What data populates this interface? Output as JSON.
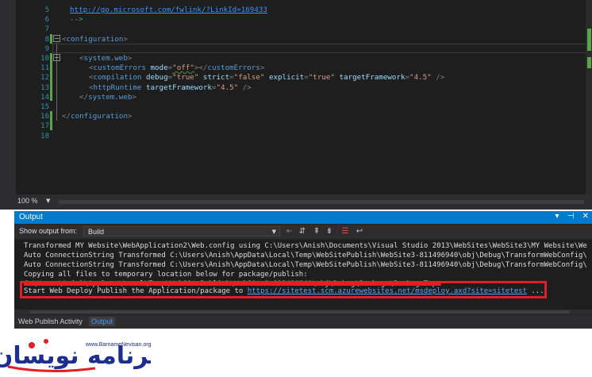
{
  "editor": {
    "lines": [
      {
        "num": "5",
        "code": [
          {
            "t": "link",
            "v": "http://go.microsoft.com/fwlink/?LinkId=169433"
          }
        ]
      },
      {
        "num": "6",
        "code": [
          {
            "t": "cmt",
            "v": "-->"
          }
        ]
      },
      {
        "num": "7",
        "code": []
      },
      {
        "num": "8",
        "code": [
          {
            "t": "punc",
            "v": "<"
          },
          {
            "t": "tag",
            "v": "configuration"
          },
          {
            "t": "punc",
            "v": ">"
          }
        ]
      },
      {
        "num": "9",
        "code": []
      },
      {
        "num": "10",
        "code": [
          {
            "t": "punc",
            "v": "<"
          },
          {
            "t": "tag",
            "v": "system.web"
          },
          {
            "t": "punc",
            "v": ">"
          }
        ]
      },
      {
        "num": "11",
        "code": [
          {
            "t": "punc",
            "v": "<"
          },
          {
            "t": "tag",
            "v": "customErrors"
          },
          {
            "t": "txt",
            "v": " "
          },
          {
            "t": "attr",
            "v": "mode"
          },
          {
            "t": "punc",
            "v": "="
          },
          {
            "t": "val",
            "v": "\"off\""
          },
          {
            "t": "punc",
            "v": "></"
          },
          {
            "t": "tag",
            "v": "customErrors"
          },
          {
            "t": "punc",
            "v": ">"
          }
        ]
      },
      {
        "num": "12",
        "code": [
          {
            "t": "punc",
            "v": "<"
          },
          {
            "t": "tag",
            "v": "compilation"
          },
          {
            "t": "txt",
            "v": " "
          },
          {
            "t": "attr",
            "v": "debug"
          },
          {
            "t": "punc",
            "v": "="
          },
          {
            "t": "val",
            "v": "\"true\""
          },
          {
            "t": "txt",
            "v": " "
          },
          {
            "t": "attr",
            "v": "strict"
          },
          {
            "t": "punc",
            "v": "="
          },
          {
            "t": "val",
            "v": "\"false\""
          },
          {
            "t": "txt",
            "v": " "
          },
          {
            "t": "attr",
            "v": "explicit"
          },
          {
            "t": "punc",
            "v": "="
          },
          {
            "t": "val",
            "v": "\"true\""
          },
          {
            "t": "txt",
            "v": " "
          },
          {
            "t": "attr",
            "v": "targetFramework"
          },
          {
            "t": "punc",
            "v": "="
          },
          {
            "t": "val",
            "v": "\"4.5\""
          },
          {
            "t": "txt",
            "v": " "
          },
          {
            "t": "punc",
            "v": "/>"
          }
        ]
      },
      {
        "num": "13",
        "code": [
          {
            "t": "punc",
            "v": "<"
          },
          {
            "t": "tag",
            "v": "httpRuntime"
          },
          {
            "t": "txt",
            "v": " "
          },
          {
            "t": "attr",
            "v": "targetFramework"
          },
          {
            "t": "punc",
            "v": "="
          },
          {
            "t": "val",
            "v": "\"4.5\""
          },
          {
            "t": "txt",
            "v": " "
          },
          {
            "t": "punc",
            "v": "/>"
          }
        ]
      },
      {
        "num": "14",
        "code": [
          {
            "t": "punc",
            "v": "</"
          },
          {
            "t": "tag",
            "v": "system.web"
          },
          {
            "t": "punc",
            "v": ">"
          }
        ]
      },
      {
        "num": "15",
        "code": []
      },
      {
        "num": "16",
        "code": [
          {
            "t": "punc",
            "v": "</"
          },
          {
            "t": "tag",
            "v": "configuration"
          },
          {
            "t": "punc",
            "v": ">"
          }
        ]
      },
      {
        "num": "17",
        "code": []
      },
      {
        "num": "18",
        "code": []
      }
    ],
    "zoom": "100 %"
  },
  "output": {
    "title": "Output",
    "show_output_label": "Show output from:",
    "source": "Build",
    "lines": [
      "Transformed MY Website\\WebApplication2\\Web.config using C:\\Users\\Anish\\Documents\\Visual Studio 2013\\WebSites\\WebSite3\\MY Website\\We",
      "Auto ConnectionString Transformed C:\\Users\\Anish\\AppData\\Local\\Temp\\WebSitePublish\\WebSite3-811496940\\obj\\Debug\\TransformWebConfig\\",
      "Auto ConnectionString Transformed C:\\Users\\Anish\\AppData\\Local\\Temp\\WebSitePublish\\WebSite3-811496940\\obj\\Debug\\TransformWebConfig\\",
      "Copying all files to temporary location below for package/publish:",
      "C:\\Users\\Anish\\AppData\\Local\\Temp\\WebSitePublish\\WebSite3-811496940\\obj\\Debug\\Package\\PackageTmp."
    ],
    "publish_prefix": "Start Web Deploy Publish the Application/package to ",
    "publish_url": "https://sitetest.scm.azurewebsites.net/msdeploy.axd?site=sitetest",
    "publish_suffix": " ...",
    "tabs": [
      "Web Publish Activity",
      "Output"
    ]
  },
  "watermark": {
    "url": "www.BarnameNevisan.org",
    "logo_text": "برنامه نویسان",
    "colors": {
      "blue": "#1c2f8f",
      "red": "#e31e24"
    }
  }
}
